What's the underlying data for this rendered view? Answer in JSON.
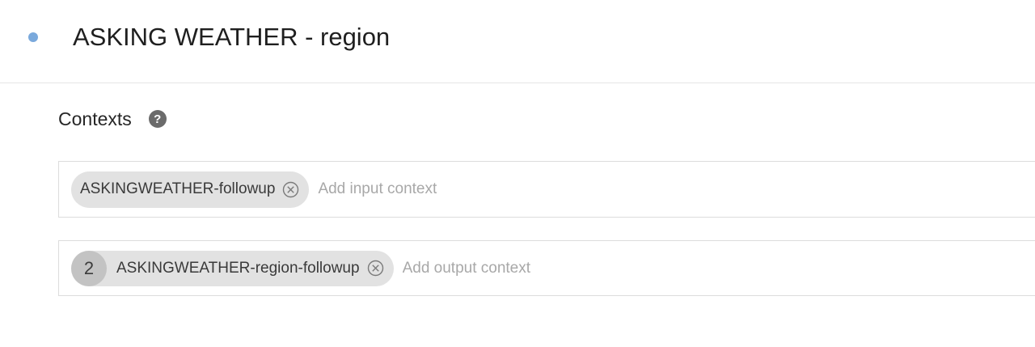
{
  "header": {
    "title": "ASKING WEATHER - region",
    "status_color": "#7aa9dc",
    "status_icon": "dot-icon"
  },
  "contexts": {
    "title": "Contexts",
    "help_icon": "help-icon",
    "input": {
      "chips": [
        {
          "label": "ASKINGWEATHER-followup",
          "remove_icon": "close-circle-icon"
        }
      ],
      "placeholder": "Add input context"
    },
    "output": {
      "chips": [
        {
          "lifespan": "2",
          "label": "ASKINGWEATHER-region-followup",
          "remove_icon": "close-circle-icon"
        }
      ],
      "placeholder": "Add output context"
    }
  }
}
